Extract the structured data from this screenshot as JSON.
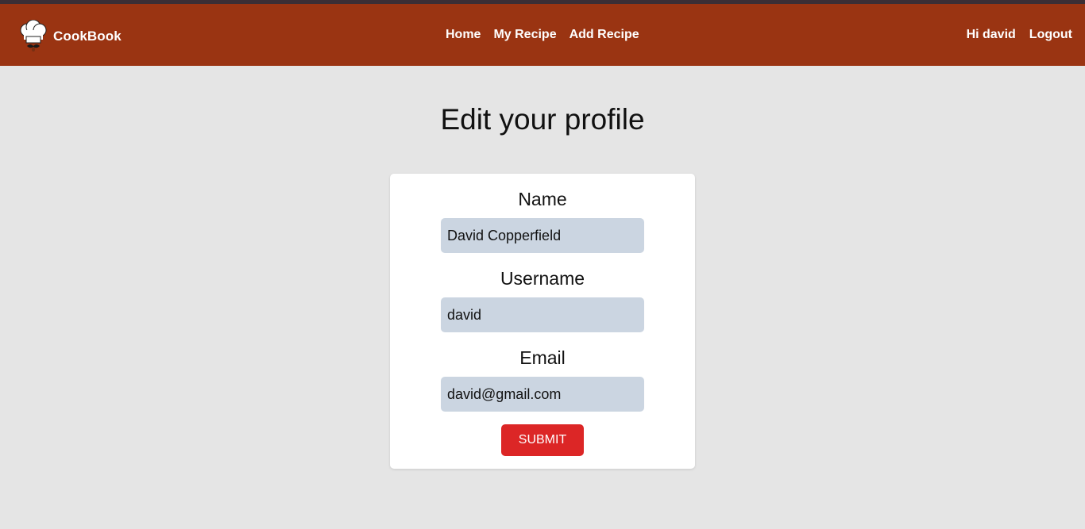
{
  "app": {
    "brand_name": "CookBook",
    "brand_color": "#9a3412",
    "logo_icon": "chef-hat-icon"
  },
  "nav": {
    "center_links": [
      "Home",
      "My Recipe",
      "Add Recipe"
    ],
    "greeting": "Hi david",
    "logout_label": "Logout"
  },
  "page": {
    "title": "Edit your profile"
  },
  "form": {
    "name_label": "Name",
    "name_value": "David Copperfield",
    "username_label": "Username",
    "username_value": "david",
    "email_label": "Email",
    "email_value": "david@gmail.com",
    "submit_label": "SUBMIT",
    "input_bg": "#cbd5e1",
    "submit_color": "#dc2626"
  }
}
